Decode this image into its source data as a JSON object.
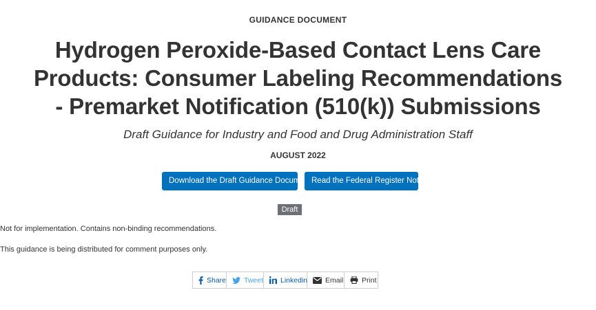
{
  "header": {
    "eyebrow": "GUIDANCE DOCUMENT",
    "title": "Hydrogen Peroxide-Based Contact Lens Care Products: Consumer Labeling Recommendations - Premarket Notification (510(k)) Submissions",
    "subtitle": "Draft Guidance for Industry and Food and Drug Administration Staff",
    "date": "AUGUST 2022"
  },
  "actions": {
    "download_label": "Download the Draft Guidance Document",
    "federal_register_label": "Read the Federal Register Notice",
    "accent_color": "#0071bc"
  },
  "status": {
    "badge": "Draft",
    "badge_color": "#6c7075",
    "note_1": "Not for implementation. Contains non-binding recommendations.",
    "note_2": "This guidance is being distributed for comment purposes only."
  },
  "share": {
    "items": [
      {
        "label": "Share",
        "icon": "facebook-icon"
      },
      {
        "label": "Tweet",
        "icon": "twitter-icon"
      },
      {
        "label": "Linkedin",
        "icon": "linkedin-icon"
      },
      {
        "label": "Email",
        "icon": "envelope-icon"
      },
      {
        "label": "Print",
        "icon": "printer-icon"
      }
    ]
  }
}
